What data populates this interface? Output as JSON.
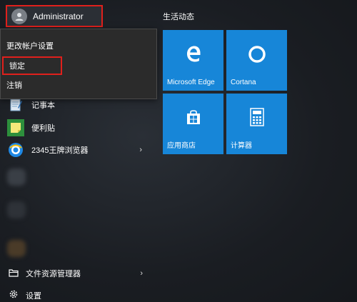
{
  "user": {
    "name": "Administrator"
  },
  "account_menu": {
    "items": [
      "更改帐户设置",
      "锁定",
      "注销"
    ]
  },
  "apps": [
    {
      "label": "记事本",
      "icon": "notepad-icon"
    },
    {
      "label": "便利贴",
      "icon": "sticky-notes-icon"
    },
    {
      "label": "2345王牌浏览器",
      "icon": "browser-2345-icon"
    }
  ],
  "system": {
    "file_explorer": "文件资源管理器",
    "settings": "设置"
  },
  "tiles": {
    "group_title": "生活动态",
    "items": [
      {
        "label": "Microsoft Edge",
        "icon": "edge-icon"
      },
      {
        "label": "Cortana",
        "icon": "cortana-icon"
      },
      {
        "label": "应用商店",
        "icon": "store-icon"
      },
      {
        "label": "计算器",
        "icon": "calculator-icon"
      }
    ]
  },
  "colors": {
    "accent": "#1786d8",
    "highlight": "#e0201c"
  }
}
